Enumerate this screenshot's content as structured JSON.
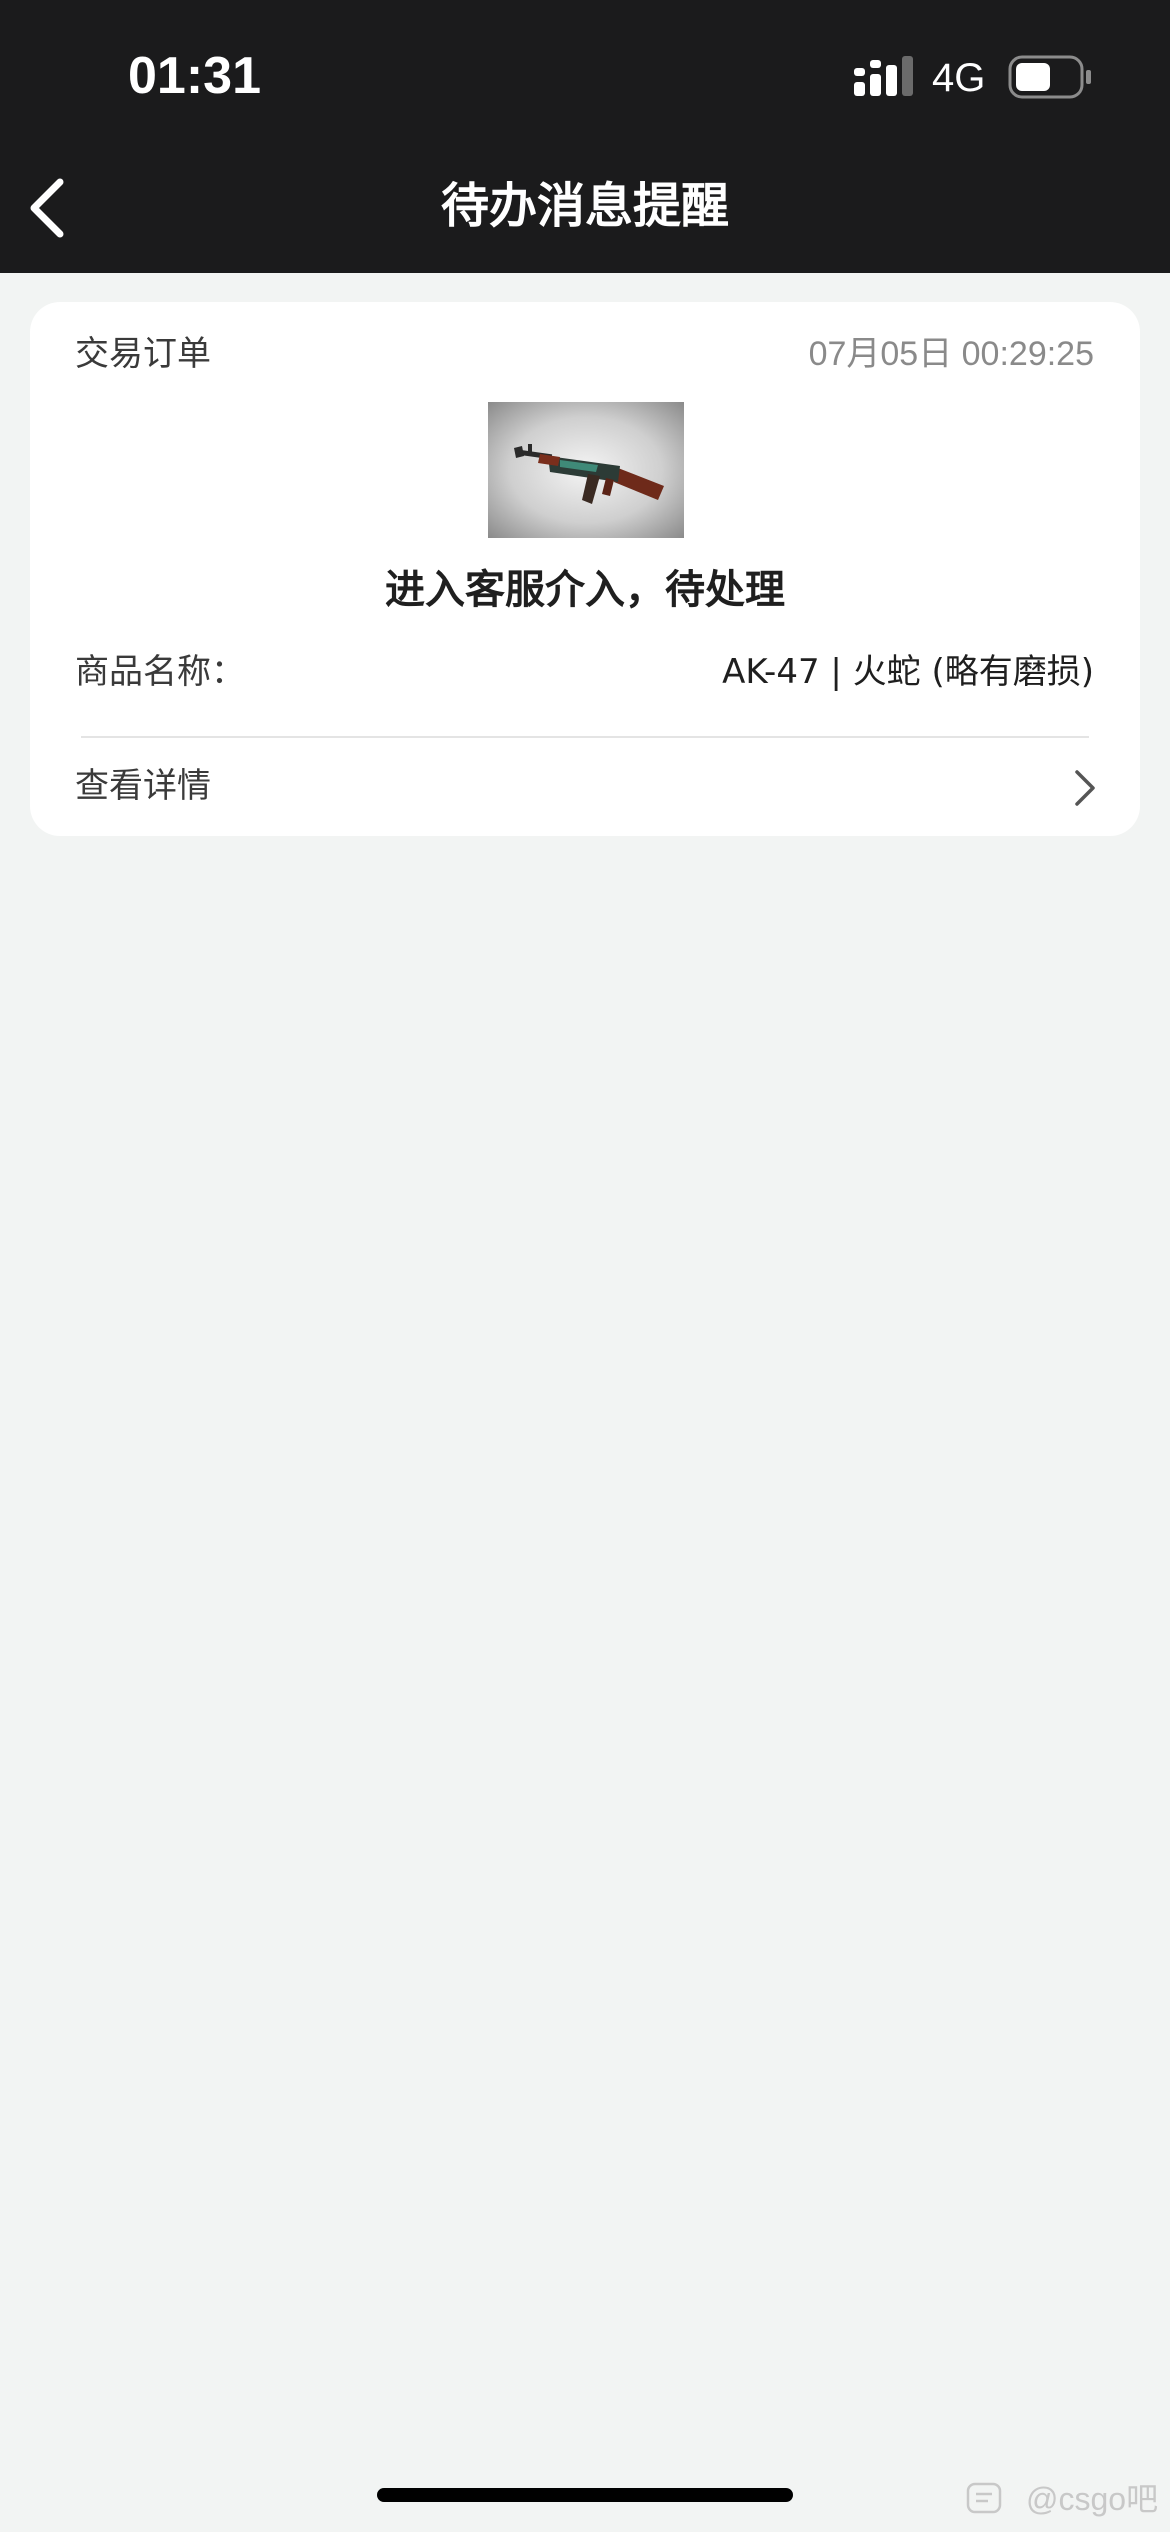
{
  "status_bar": {
    "time": "01:31",
    "network": "4G",
    "battery_level": 0.5
  },
  "nav": {
    "title": "待办消息提醒",
    "back_icon": "chevron-left-icon"
  },
  "card": {
    "order_type": "交易订单",
    "timestamp": "07月05日 00:29:25",
    "item_image_icon": "rifle-image",
    "status_message": "进入客服介入，待处理",
    "product_label": "商品名称：",
    "product_name": "AK-47 | 火蛇 (略有磨损)",
    "detail_link": "查看详情",
    "detail_icon": "chevron-right-icon"
  },
  "watermark": {
    "text": "@csgo吧"
  },
  "colors": {
    "topbar": "#1b1b1c",
    "background": "#f2f4f3",
    "card": "#ffffff",
    "muted_text": "#8a8a8a"
  }
}
